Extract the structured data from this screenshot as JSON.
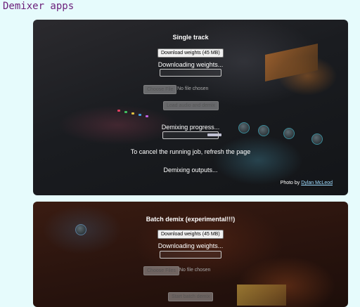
{
  "app": {
    "title": "Demixer apps"
  },
  "single": {
    "heading": "Single track",
    "download_label": "Download weights (45 MB)",
    "downloading_text": "Downloading weights...",
    "choose_file_label": "Choose File",
    "no_file_text": "No file chosen",
    "load_demix_label": "Load audio and demix",
    "demixing_progress_text": "Demixing progress...",
    "cancel_text": "To cancel the running job, refresh the page",
    "outputs_text": "Demixing outputs...",
    "credit_prefix": "Photo by",
    "credit_author": "Dylan McLeod"
  },
  "batch": {
    "heading": "Batch demix (experimental!!!)",
    "download_label": "Download weights (45 MB)",
    "downloading_text": "Downloading weights...",
    "choose_file_label": "Choose Files",
    "no_file_text": "No file chosen",
    "start_label": "Start batch demix"
  },
  "colors": {
    "page_bg": "#e6fbfc",
    "title_color": "#6b1f7a"
  }
}
